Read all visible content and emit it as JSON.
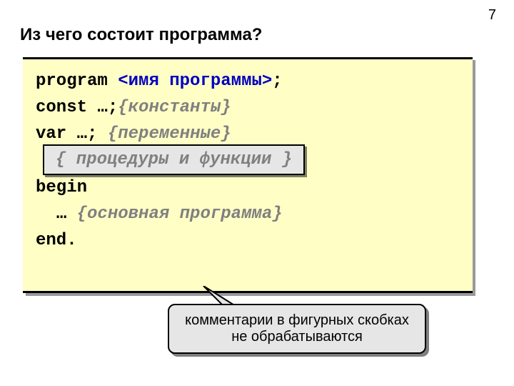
{
  "pageNumber": "7",
  "title": "Из чего состоит программа?",
  "code": {
    "kw_program": "program",
    "ph_progname": "<имя программы>",
    "semi1": ";",
    "kw_const": "const",
    "ell1": "…;",
    "cm_const": "{константы}",
    "kw_var": "var",
    "ell2": "…;",
    "cm_var": "{переменные}",
    "procfunc": "{ процедуры и функции }",
    "kw_begin": "begin",
    "ell3": "…",
    "cm_main": "{основная программа}",
    "kw_end": "end."
  },
  "callout": {
    "line1": "комментарии в фигурных скобках",
    "line2": "не обрабатываются"
  }
}
